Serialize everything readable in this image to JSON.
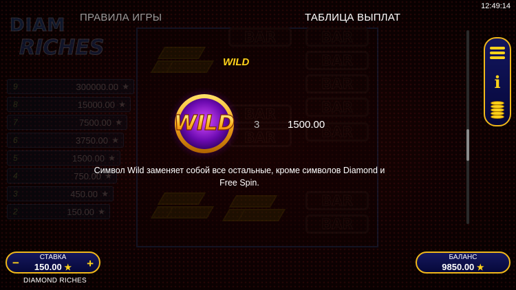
{
  "clock": "12:49:14",
  "tabs": {
    "rules": "ПРАВИЛА ИГРЫ",
    "paytable": "ТАБЛИЦА ВЫПЛАТ"
  },
  "paytable": {
    "symbol_title": "WILD",
    "symbol_icon_text": "WILD",
    "count": "3",
    "payout": "1500.00",
    "description": "Символ Wild заменяет собой все остальные, кроме символов Diamond и Free Spin."
  },
  "background": {
    "logo_line1": "DIAM",
    "logo_line2": "RICHES",
    "ladder": [
      {
        "n": "9",
        "v": "300000.00"
      },
      {
        "n": "8",
        "v": "15000.00"
      },
      {
        "n": "7",
        "v": "7500.00"
      },
      {
        "n": "6",
        "v": "3750.00"
      },
      {
        "n": "5",
        "v": "1500.00"
      },
      {
        "n": "4",
        "v": "750.00"
      },
      {
        "n": "3",
        "v": "450.00"
      },
      {
        "n": "2",
        "v": "150.00"
      }
    ],
    "bar_label": "BAR"
  },
  "bet": {
    "label": "СТАВКА",
    "value": "150.00",
    "minus": "−",
    "plus": "+"
  },
  "balance": {
    "label": "БАЛАНС",
    "value": "9850.00"
  },
  "game_name": "DIAMOND RICHES",
  "colors": {
    "accent_gold": "#ffd21a",
    "panel_blue": "#15185e",
    "background_red": "#3a0606"
  }
}
